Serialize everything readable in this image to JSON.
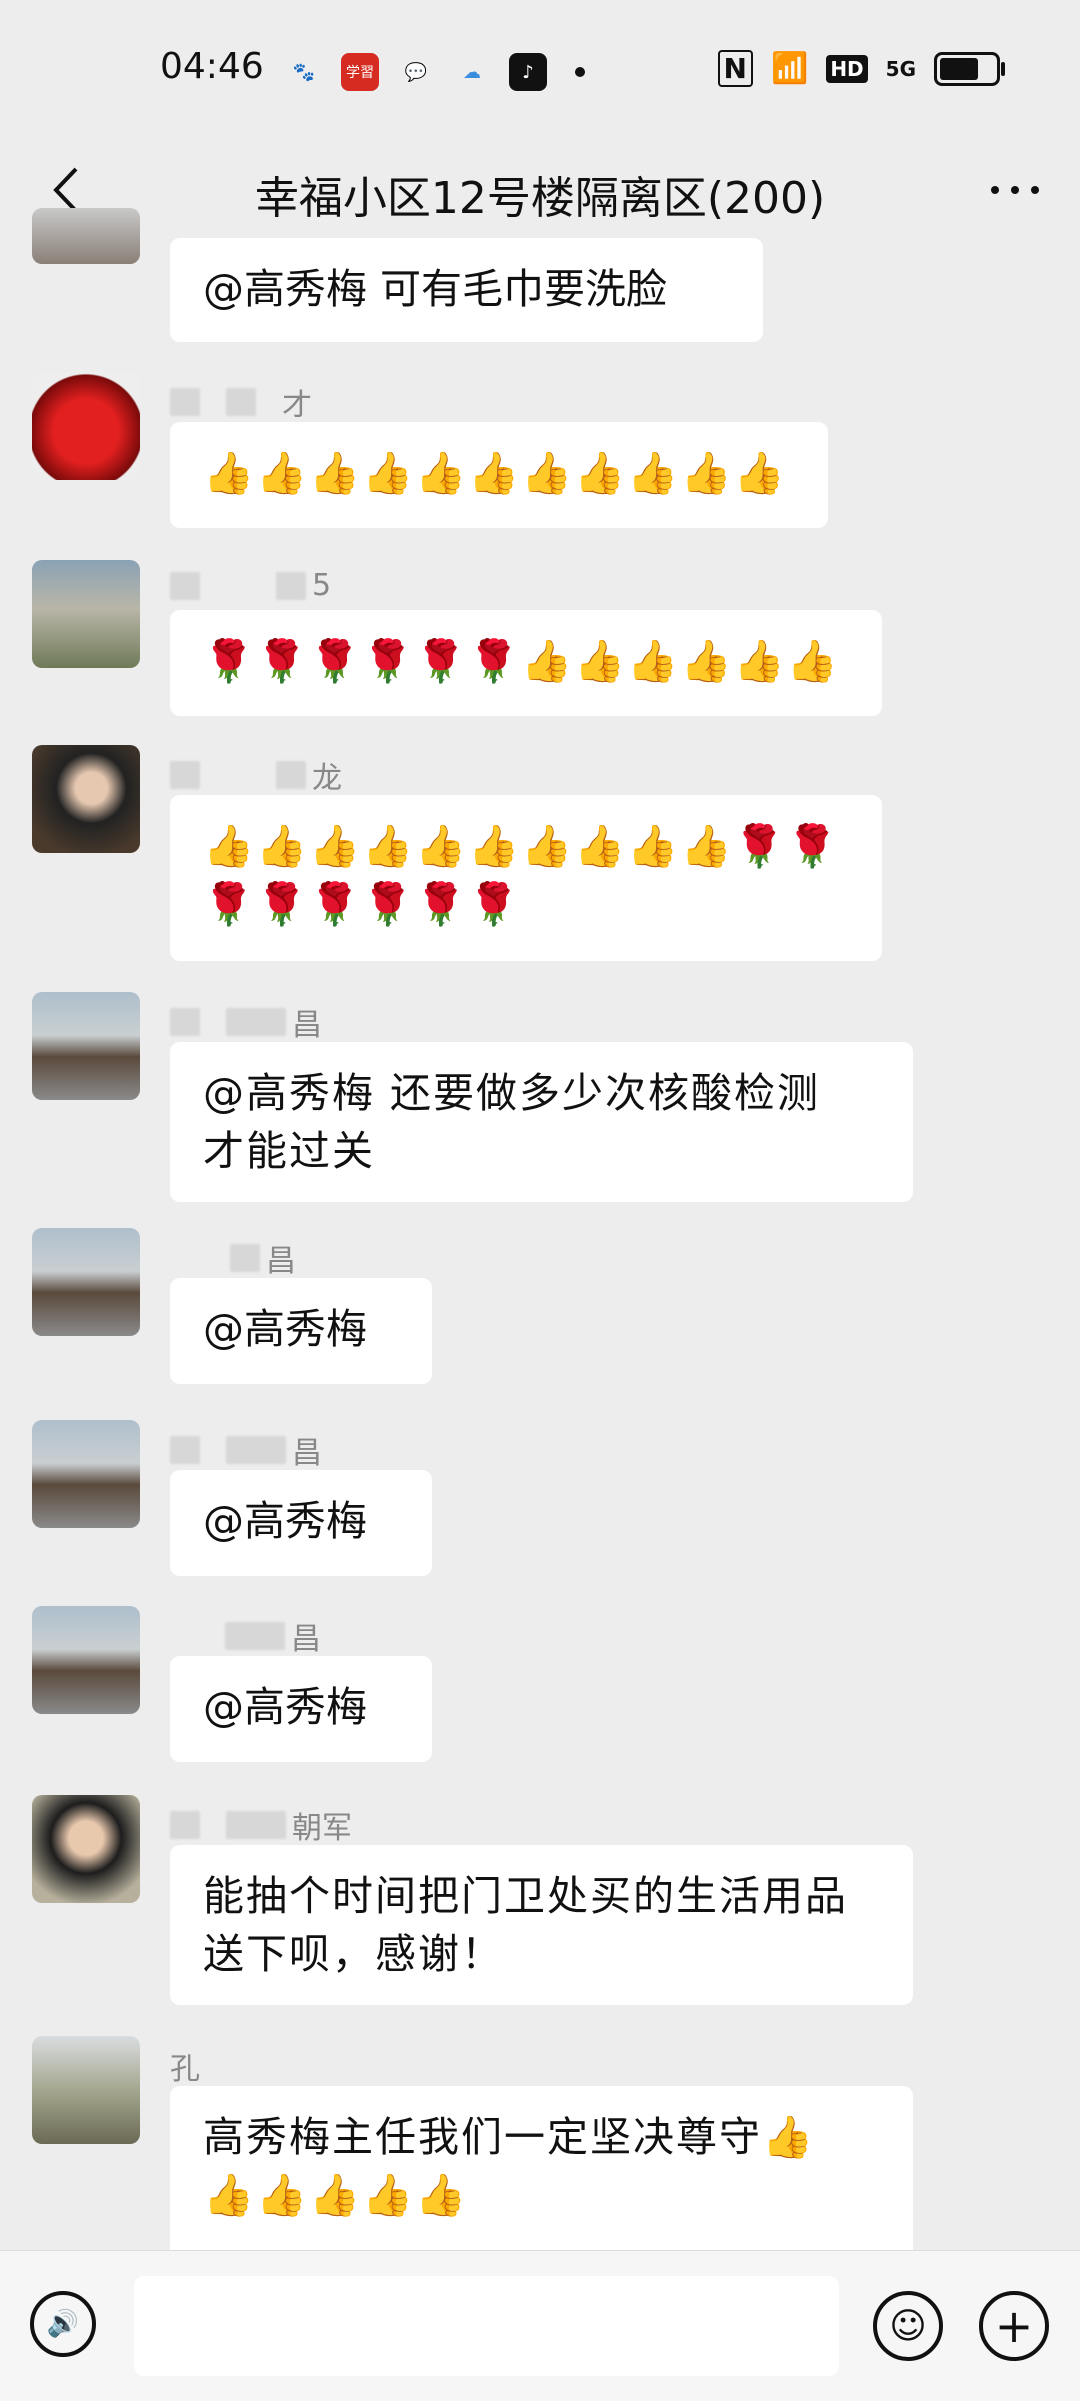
{
  "status_bar": {
    "time": "04:46",
    "signal_label": "5G",
    "hd_label": "HD",
    "nfc_label": "N",
    "apps": [
      {
        "name": "baidu-icon",
        "glyph": "🐾",
        "color": "#ffffff"
      },
      {
        "name": "xuexi-icon",
        "glyph": "学習",
        "color": "#d62b20"
      },
      {
        "name": "chat-icon",
        "glyph": "💬",
        "color": "#ffffff"
      },
      {
        "name": "cloud-icon",
        "glyph": "☁",
        "color": "#ffffff"
      },
      {
        "name": "tiktok-icon",
        "glyph": "♪",
        "color": "#111111"
      }
    ]
  },
  "header": {
    "title": "幸福小区12号楼隔离区(200)",
    "back_glyph": "‹",
    "more_glyph": "···"
  },
  "messages": [
    {
      "sender": "",
      "lines": [
        "@高秀梅  可有毛巾要洗脸"
      ]
    },
    {
      "sender": "才",
      "lines": [
        "👍👍👍👍👍👍👍👍👍👍👍"
      ]
    },
    {
      "sender": "5",
      "lines": [
        "🌹🌹🌹🌹🌹🌹👍👍👍👍👍👍"
      ]
    },
    {
      "sender": "龙",
      "lines": [
        "👍👍👍👍👍👍👍👍👍👍🌹🌹",
        "🌹🌹🌹🌹🌹🌹"
      ]
    },
    {
      "sender": "昌",
      "lines": [
        "@高秀梅  还要做多少次核酸检测",
        "才能过关"
      ]
    },
    {
      "sender": "昌",
      "lines": [
        "@高秀梅"
      ]
    },
    {
      "sender": "昌",
      "lines": [
        "@高秀梅"
      ]
    },
    {
      "sender": "昌",
      "lines": [
        "@高秀梅"
      ]
    },
    {
      "sender": "朝军",
      "lines": [
        "能抽个时间把门卫处买的生活用品",
        "送下呗，感谢！"
      ]
    },
    {
      "sender": "孔",
      "lines": [
        "高秀梅主任我们一定坚决尊守👍",
        "👍👍👍👍👍"
      ]
    }
  ],
  "input_bar": {
    "voice_glyph": "🔊",
    "emoji_glyph": "☺",
    "plus_glyph": "+"
  }
}
